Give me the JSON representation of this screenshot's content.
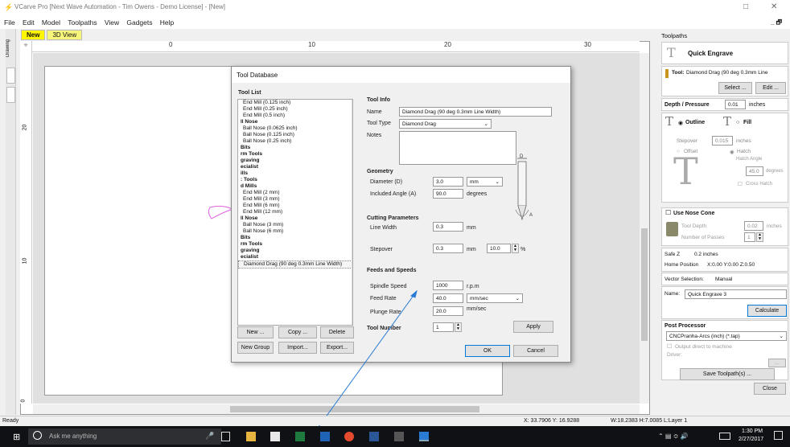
{
  "window": {
    "title": "VCarve Pro [Next Wave Automation - Tim Owens - Demo License] - [New]"
  },
  "menu": {
    "items": [
      "File",
      "Edit",
      "Model",
      "Toolpaths",
      "View",
      "Gadgets",
      "Help"
    ],
    "restore_label": "_ &#x1F5D7;"
  },
  "doc_tabs": {
    "new": "New",
    "view3d": "3D View"
  },
  "side_tab": {
    "drawing": "Drawing"
  },
  "ruler": {
    "top": [
      "0",
      "10",
      "20",
      "30"
    ],
    "left": [
      "20",
      "10",
      "0"
    ]
  },
  "dialog": {
    "title": "Tool Database",
    "tool_list_label": "Tool List",
    "tool_list": [
      {
        "t": "End Mill (0.125 inch)",
        "b": false
      },
      {
        "t": "End Mill (0.25 inch)",
        "b": false
      },
      {
        "t": "End Mill (0.5 inch)",
        "b": false
      },
      {
        "t": "ll Nose",
        "b": true
      },
      {
        "t": "Ball Nose (0.0625 inch)",
        "b": false
      },
      {
        "t": "Ball Nose (0.125 inch)",
        "b": false
      },
      {
        "t": "Ball Nose (0.25 inch)",
        "b": false
      },
      {
        "t": "Bits",
        "b": true
      },
      {
        "t": "rm Tools",
        "b": true
      },
      {
        "t": "graving",
        "b": true
      },
      {
        "t": "ecialist",
        "b": true
      },
      {
        "t": "ills",
        "b": true
      },
      {
        "t": ": Tools",
        "b": true
      },
      {
        "t": "d Mills",
        "b": true
      },
      {
        "t": "End Mill (2 mm)",
        "b": false
      },
      {
        "t": "End Mill (3 mm)",
        "b": false
      },
      {
        "t": "End Mill (6 mm)",
        "b": false
      },
      {
        "t": "End Mill (12 mm)",
        "b": false
      },
      {
        "t": "ll Nose",
        "b": true
      },
      {
        "t": "Ball Nose (3 mm)",
        "b": false
      },
      {
        "t": "Ball Nose (6 mm)",
        "b": false
      },
      {
        "t": "Bits",
        "b": true
      },
      {
        "t": "rm Tools",
        "b": true
      },
      {
        "t": "graving",
        "b": true
      },
      {
        "t": "ecialist",
        "b": true
      },
      {
        "t": "Diamond Drag (90 deg 0.3mm Line Width)",
        "b": false,
        "sel": true
      }
    ],
    "tool_info_label": "Tool Info",
    "name_label": "Name",
    "name_value": "Diamond Drag (90 deg 0.3mm Line Width)",
    "type_label": "Tool Type",
    "type_value": "Diamond Drag",
    "notes_label": "Notes",
    "geometry_label": "Geometry",
    "diameter_label": "Diameter (D)",
    "diameter_value": "3.0",
    "diameter_unit": "mm",
    "angle_label": "Included Angle (A)",
    "angle_value": "90.0",
    "angle_unit": "degrees",
    "cutting_label": "Cutting Parameters",
    "linewidth_label": "Line Width",
    "linewidth_value": "0.3",
    "linewidth_unit": "mm",
    "stepover_label": "Stepover",
    "stepover_value": "0.3",
    "stepover_unit": "mm",
    "stepover_pct": "10.0",
    "pct": "%",
    "feeds_label": "Feeds and Speeds",
    "spindle_label": "Spindle Speed",
    "spindle_value": "1000",
    "spindle_unit": "r.p.m",
    "feed_label": "Feed Rate",
    "feed_value": "40.0",
    "feed_unit": "mm/sec",
    "plunge_label": "Plunge Rate",
    "plunge_value": "20.0",
    "plunge_unit": "mm/sec",
    "toolnum_label": "Tool Number",
    "toolnum_value": "1",
    "buttons": {
      "new": "New ...",
      "copy": "Copy ...",
      "delete": "Delete",
      "newgroup": "New Group",
      "import": "Import...",
      "export": "Export...",
      "apply": "Apply",
      "ok": "OK",
      "cancel": "Cancel"
    },
    "diagram": {
      "d": "D",
      "a": "A"
    }
  },
  "panel": {
    "header": "Toolpaths",
    "title": "Quick Engrave",
    "tool_label": "Tool:",
    "tool_value": "Diamond Drag (90 deg 0.3mm Line",
    "select_btn": "Select ...",
    "edit_btn": "Edit ...",
    "depth_label": "Depth / Pressure",
    "depth_value": "0.01",
    "depth_unit": "inches",
    "outline": "Outline",
    "fill": "Fill",
    "stepover_label": "Stepover",
    "stepover_value": "0.015",
    "stepover_unit": "inches",
    "offset": "Offset",
    "hatch": "Hatch",
    "hatch_angle": "Hatch Angle",
    "hatch_value": "45.0",
    "hatch_unit": "degrees",
    "cross_hatch": "Cross Hatch",
    "nose_cone": "Use Nose Cone",
    "tool_depth": "Tool Depth",
    "tool_depth_value": "0.02",
    "tool_depth_unit": "inches",
    "passes": "Number of Passes",
    "passes_value": "1",
    "safe_z": "Safe Z",
    "safe_z_value": "0.2 inches",
    "home": "Home Position",
    "home_value": "X:0.00 Y:0.00 Z:0.50",
    "vector_sel": "Vector Selection:",
    "vector_sel_value": "Manual",
    "name_label": "Name:",
    "name_value": "Quick Engrave 3",
    "calculate": "Calculate",
    "post_label": "Post Processor",
    "post_value": "CNCPranha-Arcs (inch) (*.tap)",
    "output_direct": "Output direct to machine",
    "driver": "Driver:",
    "driver_btn": "...",
    "save": "Save Toolpath(s) ...",
    "close": "Close"
  },
  "status": {
    "ready": "Ready",
    "coords": "X: 33.7906 Y: 16.9288",
    "wh": "W:18.2383  H:7.0085  L:Layer 1"
  },
  "taskbar": {
    "search": "Ask me anything",
    "time": "1:30 PM",
    "date": "2/27/2017"
  }
}
